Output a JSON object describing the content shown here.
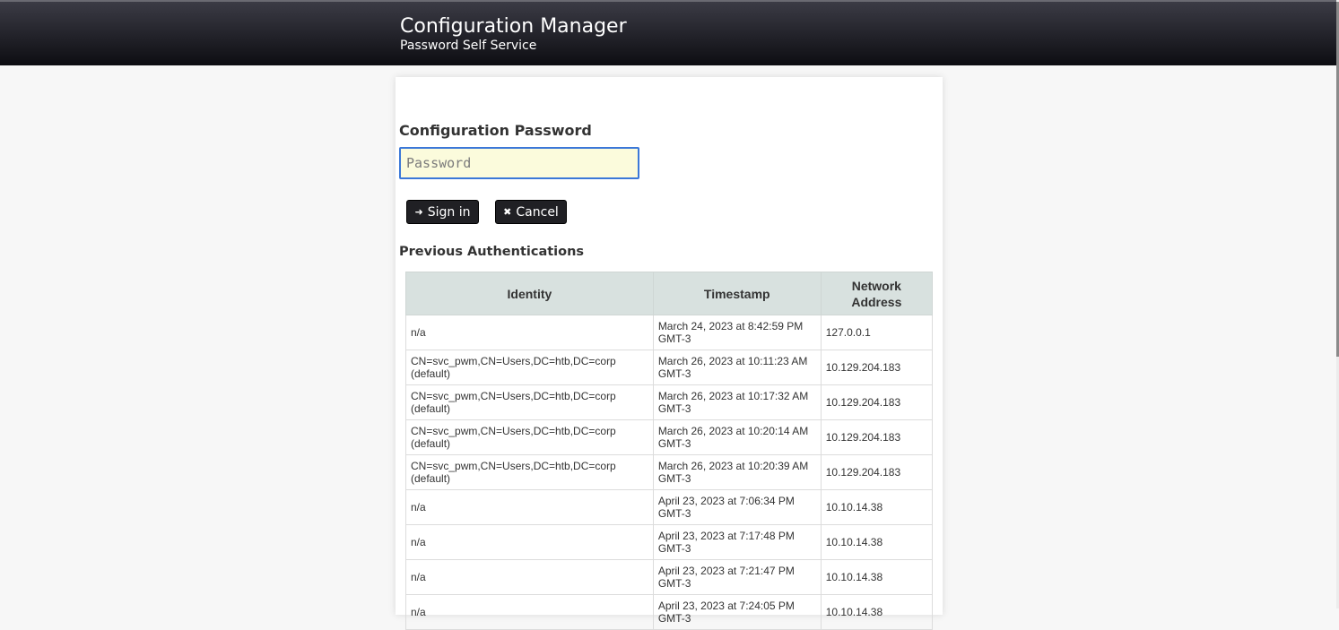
{
  "header": {
    "title": "Configuration Manager",
    "subtitle": "Password Self Service"
  },
  "form": {
    "password_label": "Configuration Password",
    "password_placeholder": "Password",
    "password_value": "",
    "signin_label": "Sign in",
    "cancel_label": "Cancel"
  },
  "previous": {
    "heading": "Previous Authentications",
    "columns": [
      "Identity",
      "Timestamp",
      "Network\nAddress"
    ],
    "rows": [
      {
        "identity": "n/a",
        "timestamp": "March 24, 2023 at 8:42:59 PM GMT-3",
        "address": "127.0.0.1"
      },
      {
        "identity": "CN=svc_pwm,CN=Users,DC=htb,DC=corp (default)",
        "timestamp": "March 26, 2023 at 10:11:23 AM GMT-3",
        "address": "10.129.204.183"
      },
      {
        "identity": "CN=svc_pwm,CN=Users,DC=htb,DC=corp (default)",
        "timestamp": "March 26, 2023 at 10:17:32 AM GMT-3",
        "address": "10.129.204.183"
      },
      {
        "identity": "CN=svc_pwm,CN=Users,DC=htb,DC=corp (default)",
        "timestamp": "March 26, 2023 at 10:20:14 AM GMT-3",
        "address": "10.129.204.183"
      },
      {
        "identity": "CN=svc_pwm,CN=Users,DC=htb,DC=corp (default)",
        "timestamp": "March 26, 2023 at 10:20:39 AM GMT-3",
        "address": "10.129.204.183"
      },
      {
        "identity": "n/a",
        "timestamp": "April 23, 2023 at 7:06:34 PM GMT-3",
        "address": "10.10.14.38"
      },
      {
        "identity": "n/a",
        "timestamp": "April 23, 2023 at 7:17:48 PM GMT-3",
        "address": "10.10.14.38"
      },
      {
        "identity": "n/a",
        "timestamp": "April 23, 2023 at 7:21:47 PM GMT-3",
        "address": "10.10.14.38"
      },
      {
        "identity": "n/a",
        "timestamp": "April 23, 2023 at 7:24:05 PM GMT-3",
        "address": "10.10.14.38"
      }
    ]
  },
  "icons": {
    "signin": "sign-in-icon",
    "cancel": "close-icon"
  },
  "colors": {
    "header_bg": "#0d0d12",
    "button_bg": "#202024",
    "table_header_bg": "#d8e1df",
    "input_bg": "#fbfbdc",
    "input_border": "#3b78d8"
  }
}
